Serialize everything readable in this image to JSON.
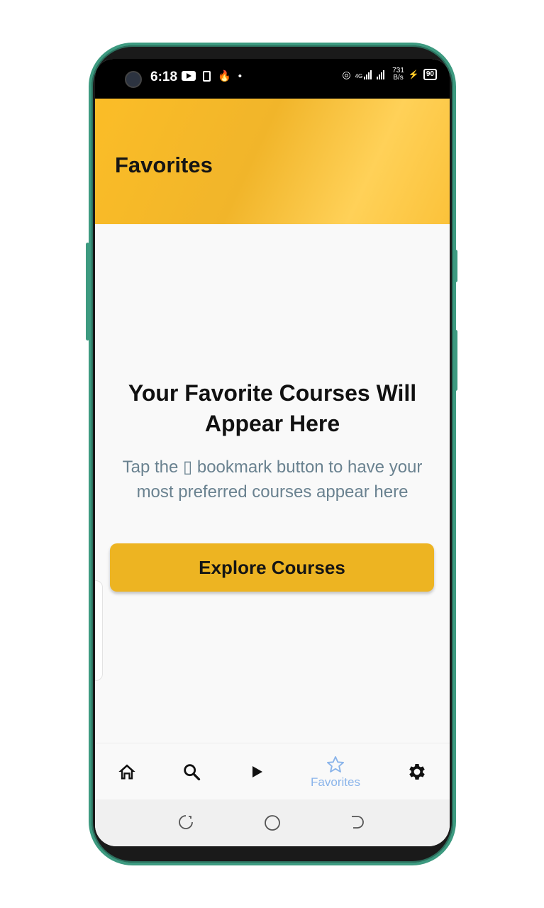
{
  "status_bar": {
    "time": "6:18",
    "network": "4G",
    "net_speed_value": "731",
    "net_speed_unit": "B/s",
    "battery": "90"
  },
  "header": {
    "title": "Favorites"
  },
  "empty_state": {
    "title": "Your Favorite Courses Will Appear Here",
    "subtitle": "Tap the ▯ bookmark button to have your most preferred courses appear here",
    "button_label": "Explore Courses"
  },
  "bottom_nav": {
    "items": [
      {
        "icon": "home-icon",
        "label": ""
      },
      {
        "icon": "search-icon",
        "label": ""
      },
      {
        "icon": "play-icon",
        "label": ""
      },
      {
        "icon": "star-icon",
        "label": "Favorites",
        "active": true
      },
      {
        "icon": "gear-icon",
        "label": ""
      }
    ]
  },
  "colors": {
    "accent": "#edb422",
    "header_gradient": [
      "#fbbd27",
      "#ffd158"
    ],
    "active_nav": "#8ab4ea",
    "subtitle": "#6a8290",
    "phone_frame": "#3d9a80"
  }
}
